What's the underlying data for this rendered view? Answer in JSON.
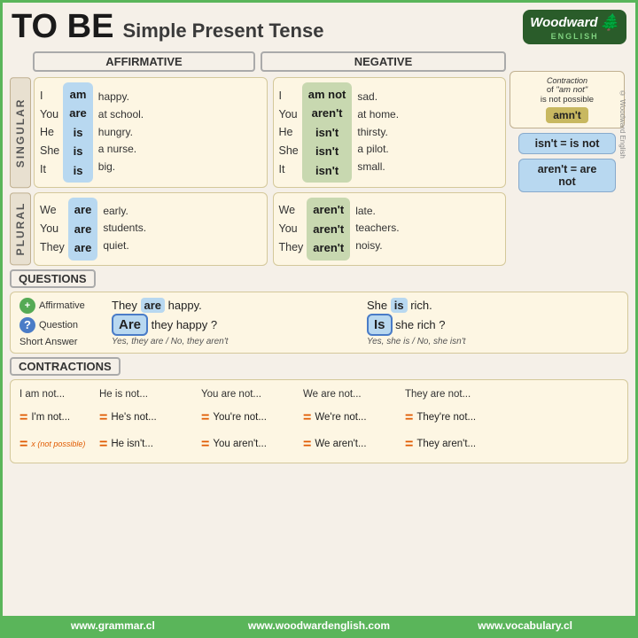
{
  "header": {
    "title_to_be": "TO BE",
    "title_subtitle": "Simple Present Tense",
    "logo_name": "Woodward",
    "logo_subtitle": "ENGLISH"
  },
  "sections": {
    "affirmative_label": "AFFIRMATIVE",
    "negative_label": "NEGATIVE",
    "singular_label": "SINGULAR",
    "plural_label": "PLURAL"
  },
  "singular": {
    "aff": {
      "pronouns": [
        "I",
        "You",
        "He",
        "She",
        "It"
      ],
      "verbs": [
        "am",
        "are",
        "is",
        "is",
        "is"
      ],
      "complements": [
        "happy.",
        "at school.",
        "hungry.",
        "a nurse.",
        "big."
      ]
    },
    "neg": {
      "pronouns": [
        "I",
        "You",
        "He",
        "She",
        "It"
      ],
      "verbs": [
        "am not",
        "aren't",
        "isn't",
        "isn't",
        "isn't"
      ],
      "complements": [
        "sad.",
        "at home.",
        "thirsty.",
        "a pilot.",
        "small."
      ]
    }
  },
  "plural": {
    "aff": {
      "pronouns": [
        "We",
        "You",
        "They"
      ],
      "verbs": [
        "are",
        "are",
        "are"
      ],
      "complements": [
        "early.",
        "students.",
        "quiet."
      ]
    },
    "neg": {
      "pronouns": [
        "We",
        "You",
        "They"
      ],
      "verbs": [
        "aren't",
        "aren't",
        "aren't"
      ],
      "complements": [
        "late.",
        "teachers.",
        "noisy."
      ]
    }
  },
  "notes": {
    "amnt_title": "Contraction",
    "amnt_of": "of \"am not\"",
    "amnt_note": "is not possible",
    "amnt_badge": "amn't",
    "isnt_eq": "isn't = is not",
    "arent_eq": "aren't = are not"
  },
  "questions": {
    "label": "QUESTIONS",
    "affirmative_label": "Affirmative",
    "question_label": "Question",
    "short_answer_label": "Short Answer",
    "aff1": "They",
    "verb1": "are",
    "comp1": "happy.",
    "aff2": "She",
    "verb2": "is",
    "comp2": "rich.",
    "q_verb1": "Are",
    "q_rest1": "they happy ?",
    "q_verb2": "Is",
    "q_rest2": "she rich ?",
    "short1": "Yes, they are / No, they aren't",
    "short2": "Yes, she is / No, she isn't"
  },
  "contractions": {
    "label": "CONTRACTIONS",
    "col1_row1": "I am not...",
    "col1_row2": "I'm not...",
    "col1_row3": "x (not possible)",
    "col2_row1": "He is not...",
    "col2_row2": "He's not...",
    "col2_row3": "He isn't...",
    "col3_row1": "You are not...",
    "col3_row2": "You're not...",
    "col3_row3": "You aren't...",
    "col4_row1": "We are not...",
    "col4_row2": "We're not...",
    "col4_row3": "We aren't...",
    "col5_row1": "They are not...",
    "col5_row2": "They're not...",
    "col5_row3": "They aren't..."
  },
  "footer": {
    "link1": "www.grammar.cl",
    "link2": "www.woodwardenglish.com",
    "link3": "www.vocabulary.cl"
  }
}
